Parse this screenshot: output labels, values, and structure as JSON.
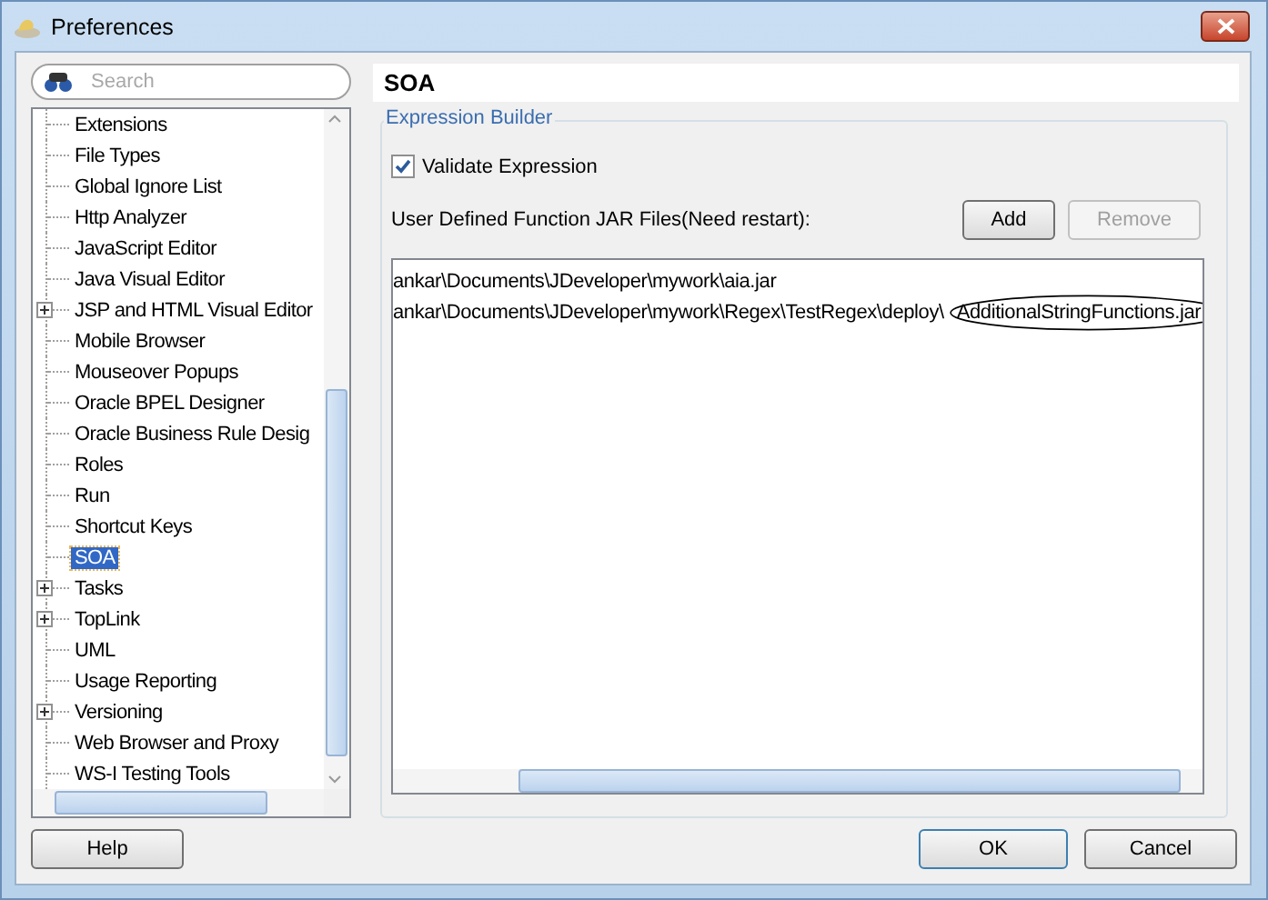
{
  "window": {
    "title": "Preferences"
  },
  "search": {
    "placeholder": "Search"
  },
  "tree": {
    "items": [
      {
        "label": "Extensions",
        "expandable": false,
        "selected": false
      },
      {
        "label": "File Types",
        "expandable": false,
        "selected": false
      },
      {
        "label": "Global Ignore List",
        "expandable": false,
        "selected": false
      },
      {
        "label": "Http Analyzer",
        "expandable": false,
        "selected": false
      },
      {
        "label": "JavaScript Editor",
        "expandable": false,
        "selected": false
      },
      {
        "label": "Java Visual Editor",
        "expandable": false,
        "selected": false
      },
      {
        "label": "JSP and HTML Visual Editor",
        "expandable": true,
        "selected": false
      },
      {
        "label": "Mobile Browser",
        "expandable": false,
        "selected": false
      },
      {
        "label": "Mouseover Popups",
        "expandable": false,
        "selected": false
      },
      {
        "label": "Oracle BPEL Designer",
        "expandable": false,
        "selected": false
      },
      {
        "label": "Oracle Business Rule Desig",
        "expandable": false,
        "selected": false
      },
      {
        "label": "Roles",
        "expandable": false,
        "selected": false
      },
      {
        "label": "Run",
        "expandable": false,
        "selected": false
      },
      {
        "label": "Shortcut Keys",
        "expandable": false,
        "selected": false
      },
      {
        "label": "SOA",
        "expandable": false,
        "selected": true
      },
      {
        "label": "Tasks",
        "expandable": true,
        "selected": false
      },
      {
        "label": "TopLink",
        "expandable": true,
        "selected": false
      },
      {
        "label": "UML",
        "expandable": false,
        "selected": false
      },
      {
        "label": "Usage Reporting",
        "expandable": false,
        "selected": false
      },
      {
        "label": "Versioning",
        "expandable": true,
        "selected": false
      },
      {
        "label": "Web Browser and Proxy",
        "expandable": false,
        "selected": false
      },
      {
        "label": "WS-I Testing Tools",
        "expandable": false,
        "selected": false
      }
    ]
  },
  "page": {
    "title": "SOA",
    "group": {
      "title": "Expression Builder",
      "validate": {
        "label": "Validate Expression",
        "checked": true
      },
      "jar_label": "User Defined Function JAR Files(Need restart):",
      "buttons": [
        {
          "label": "Add",
          "disabled": false
        },
        {
          "label": "Remove",
          "disabled": true
        }
      ],
      "files": [
        {
          "path": "ankar\\Documents\\JDeveloper\\mywork\\aia.jar"
        },
        {
          "path": "ankar\\Documents\\JDeveloper\\mywork\\Regex\\TestRegex\\deploy\\",
          "circled": "AdditionalStringFunctions.jar"
        }
      ]
    }
  },
  "buttons": {
    "help": "Help",
    "ok": "OK",
    "cancel": "Cancel"
  }
}
